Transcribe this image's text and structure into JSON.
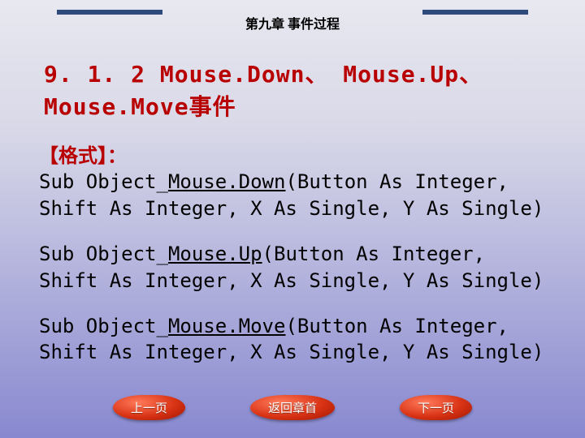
{
  "chapter_title": "第九章 事件过程",
  "section_title": "9. 1. 2 Mouse.Down、 Mouse.Up、 Mouse.Move事件",
  "format_label": "【格式】：",
  "blocks": [
    {
      "prefix": "Sub Object_",
      "keyword": "Mouse.Down",
      "suffix": "(Button As Integer, Shift As Integer, X As Single, Y As Single)"
    },
    {
      "prefix": "Sub Object_",
      "keyword": "Mouse.Up",
      "suffix": "(Button As Integer, Shift As Integer, X As Single, Y As Single)"
    },
    {
      "prefix": "Sub Object_",
      "keyword": "Mouse.Move",
      "suffix": "(Button As Integer, Shift As Integer, X As Single, Y As Single)"
    }
  ],
  "buttons": {
    "prev": "上一页",
    "home": "返回章首",
    "next": "下一页"
  }
}
